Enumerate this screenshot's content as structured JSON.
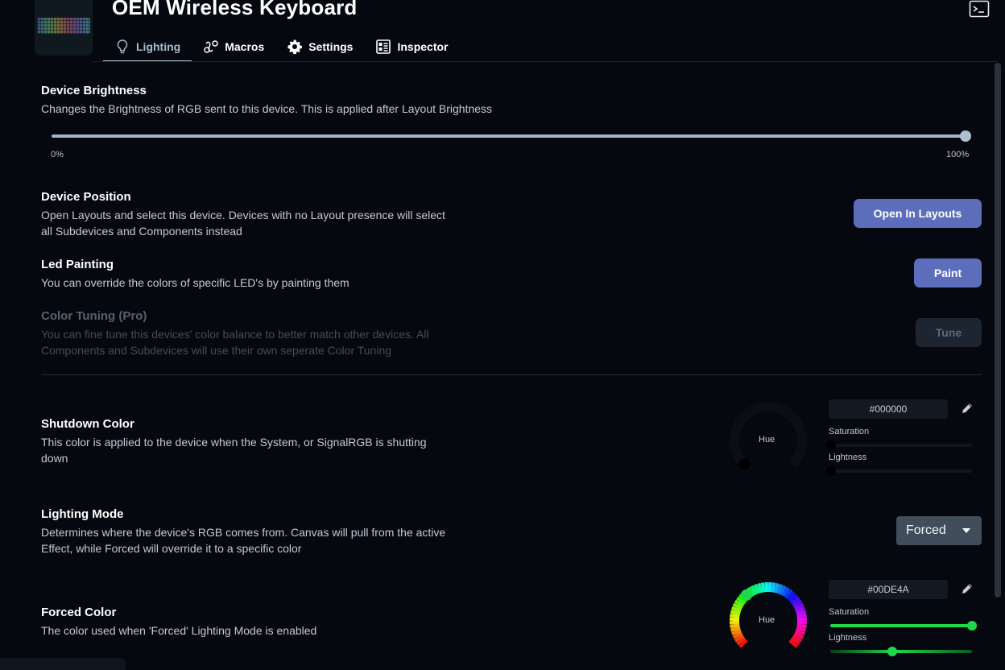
{
  "device": {
    "name": "OEM Wireless Keyboard"
  },
  "tabs": [
    {
      "label": "Lighting",
      "icon": "lightbulb-icon",
      "active": true
    },
    {
      "label": "Macros",
      "icon": "macros-icon",
      "active": false
    },
    {
      "label": "Settings",
      "icon": "gear-icon",
      "active": false
    },
    {
      "label": "Inspector",
      "icon": "inspector-icon",
      "active": false
    }
  ],
  "brightness": {
    "title": "Device Brightness",
    "desc": "Changes the Brightness of RGB sent to this device. This is applied after Layout Brightness",
    "min_label": "0%",
    "max_label": "100%",
    "value_percent": 100
  },
  "position": {
    "title": "Device Position",
    "desc_1": "Open Layouts and select this device. Devices with no Layout presence will select",
    "desc_2": "all Subdevices and Components instead",
    "button": "Open In Layouts"
  },
  "painting": {
    "title": "Led Painting",
    "desc": "You can override the colors of specific LED's by painting them",
    "button": "Paint"
  },
  "tuning": {
    "title": "Color Tuning (Pro)",
    "desc_1": "You can fine tune this devices' color balance to better match other devices. All",
    "desc_2": "Components and Subdevices will use their own seperate Color Tuning",
    "button": "Tune"
  },
  "shutdown": {
    "title": "Shutdown Color",
    "desc_1": "This color is applied to the device when the System, or SignalRGB is shutting",
    "desc_2": "down",
    "hex": "#000000",
    "hue_label": "Hue",
    "saturation_label": "Saturation",
    "lightness_label": "Lightness",
    "saturation": 0,
    "lightness": 0
  },
  "mode": {
    "title": "Lighting Mode",
    "desc_1": "Determines where the device's RGB comes from. Canvas will pull from the active",
    "desc_2": "Effect, while Forced will override it to a specific color",
    "selected": "Forced"
  },
  "forced": {
    "title": "Forced Color",
    "desc": "The color used when 'Forced' Lighting Mode is enabled",
    "hex": "#00DE4A",
    "hue_label": "Hue",
    "saturation_label": "Saturation",
    "lightness_label": "Lightness",
    "saturation": 1.0,
    "lightness": 0.5
  },
  "colors": {
    "accent_button": "#5c6dbc",
    "forced_green": "#1fd84a"
  }
}
